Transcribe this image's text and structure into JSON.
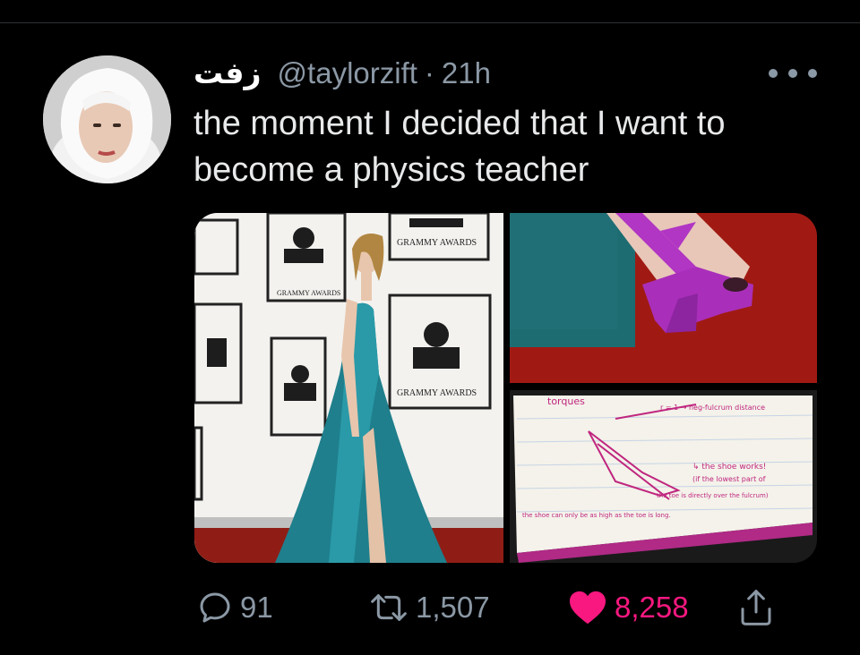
{
  "tweet": {
    "display_name": "زفت",
    "handle": "@taylorzift",
    "separator": "·",
    "time": "21h",
    "text": "the moment I decided that I want to become a physics teacher"
  },
  "media": {
    "backdrop_text": "GRAMMY AWARDS",
    "notes_title": "torques",
    "notes_lines": [
      "r = 1 → neg-fulcrum distance",
      "↳ the shoe works!",
      "(if the lowest part of",
      "the toe is directly over the fulcrum)",
      "the shoe can only be as high as the toe is long."
    ]
  },
  "actions": {
    "replies": "91",
    "retweets": "1,507",
    "likes": "8,258"
  },
  "colors": {
    "background": "#000000",
    "text": "#e7e9ea",
    "secondary": "#8b98a5",
    "like": "#f91880"
  },
  "icons": [
    "more-icon",
    "reply-icon",
    "retweet-icon",
    "heart-icon",
    "share-icon"
  ]
}
